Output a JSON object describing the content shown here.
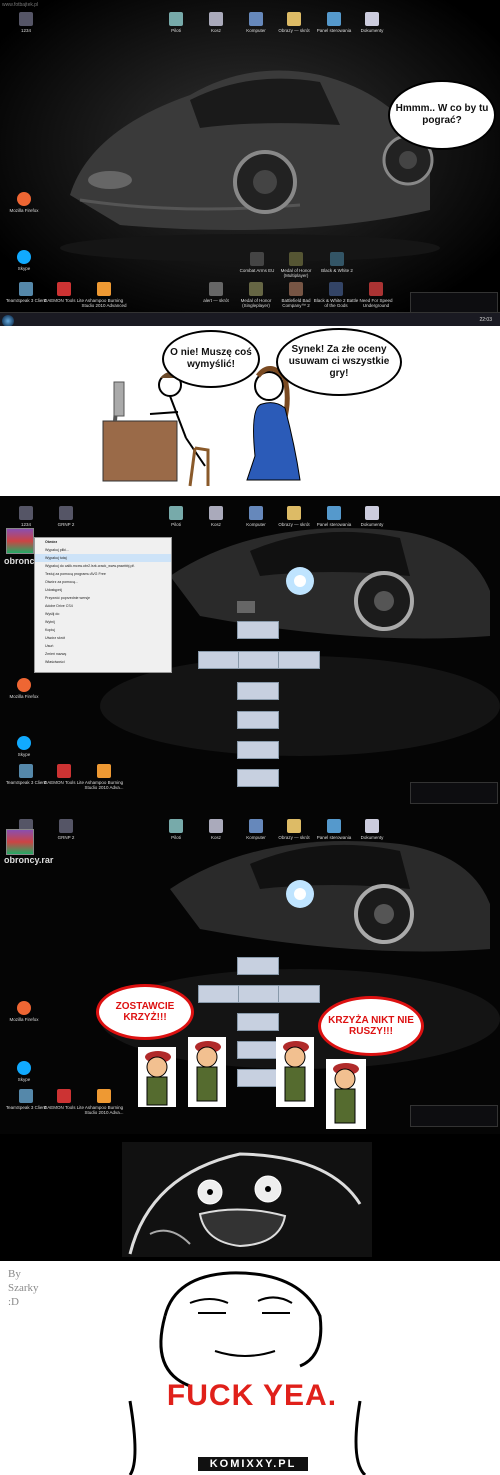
{
  "watermark_top": "www.fotbajtek.pl",
  "panel1": {
    "icons_top": [
      "1234",
      "Piloti",
      "Kosz",
      "Komputer",
      "Obrazy — skrót",
      "Panel sterowania",
      "Dokumenty"
    ],
    "icons_left": [
      "Mozilla Firefox",
      "Skype"
    ],
    "icons_games": [
      "Combat Arms EU",
      "Medal of Honor (Multiplayer)",
      "Black & White 2"
    ],
    "icons_bottom": [
      "TeamSpeak 3 Client",
      "DAEMON Tools Lite",
      "Ashampoo Burning Studio 2010 Advanced",
      "alert — skrót",
      "Medal of Honor (Singleplayer)",
      "Battlefield Bad Company™ 2",
      "Black & White 2 Battle of the Gods",
      "Need For Speed Underground"
    ],
    "bubble": "Hmmm.. W co by tu pograć?",
    "clock": "22:03"
  },
  "panel2": {
    "son_bubble": "O nie! Muszę coś wymyślić!",
    "mom_bubble": "Synek! Za złe oceny usuwam ci wszystkie gry!"
  },
  "panel3": {
    "icons_top": [
      "1234",
      "GRNP 2",
      "Piloti",
      "Kosz",
      "Komputer",
      "Obrazy — skrót",
      "Panel sterowania",
      "Dokumenty"
    ],
    "rar_label": "obroncy.rar",
    "context_menu": [
      "Otwórz",
      "Wypakuj pliki...",
      "Wypakuj tutaj",
      "Wypakuj do calik.mcxw.obr2.lsrk.crack_www.prawbbj.pl\\",
      "Testuj za pomocą programu AVG Free",
      "Otwórz za pomocą...",
      "Udostępnij",
      "Przywróć poprzednie wersje",
      "Adobe Drive CS4",
      "Wyślij do",
      "Wytnij",
      "Kopiuj",
      "Utwórz skrót",
      "Usuń",
      "Zmień nazwę",
      "Właściwości"
    ],
    "icons_left": [
      "Mozilla Firefox",
      "Skype"
    ],
    "icons_bottom": [
      "TeamSpeak 3 Client",
      "DAEMON Tools Lite",
      "Ashampoo Burning Studio 2010 Adva..."
    ]
  },
  "panel4": {
    "icons_top": [
      "1234",
      "GRNP 2",
      "Piloti",
      "Kosz",
      "Komputer",
      "Obrazy — skrót",
      "Panel sterowania",
      "Dokumenty"
    ],
    "rar_label": "obroncy.rar",
    "left_bubble": "ZOSTAWCIE KRZYŻ!!!",
    "right_bubble": "KRZYŻA NIKT NIE RUSZY!!!",
    "icons_left": [
      "Mozilla Firefox",
      "Skype"
    ],
    "icons_bottom": [
      "TeamSpeak 3 Client",
      "DAEMON Tools Lite",
      "Ashampoo Burning Studio 2010 Adva..."
    ]
  },
  "panel6": {
    "byline": "By Szarky :D",
    "fuck_yea": "FUCK YEA.",
    "logo": "KOMIXXY.PL"
  }
}
